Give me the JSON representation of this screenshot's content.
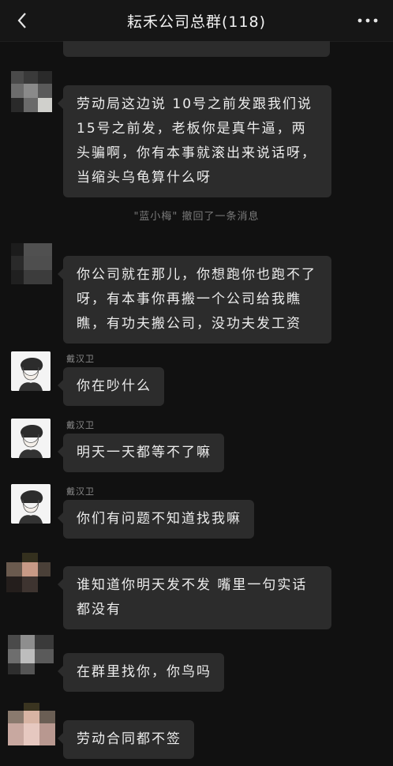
{
  "header": {
    "title": "耘禾公司总群(118)",
    "back_icon": "chevron-left-icon",
    "more_icon": "more-dots-icon"
  },
  "messages": [
    {
      "type": "text",
      "sender": "",
      "avatar": "pixelated",
      "text": "劳动局这边说 10号之前发跟我们说 15号之前发，老板你是真牛逼，两头骗啊，你有本事就滚出来说话呀，当缩头乌龟算什么呀"
    },
    {
      "type": "system",
      "text": "\"蓝小梅\" 撤回了一条消息"
    },
    {
      "type": "text",
      "sender": "",
      "avatar": "pixelated",
      "text": "你公司就在那儿，你想跑你也跑不了呀，有本事你再搬一个公司给我瞧瞧，有功夫搬公司，没功夫发工资"
    },
    {
      "type": "text",
      "sender": "戴汉卫",
      "avatar": "cartoon",
      "text": "你在吵什么"
    },
    {
      "type": "text",
      "sender": "戴汉卫",
      "avatar": "cartoon",
      "text": "明天一天都等不了嘛"
    },
    {
      "type": "text",
      "sender": "戴汉卫",
      "avatar": "cartoon",
      "text": "你们有问题不知道找我嘛"
    },
    {
      "type": "text",
      "sender": "",
      "avatar": "pixelated",
      "text": "谁知道你明天发不发 嘴里一句实话都没有"
    },
    {
      "type": "text",
      "sender": "",
      "avatar": "pixelated",
      "text": "在群里找你，你鸟吗"
    },
    {
      "type": "text",
      "sender": "",
      "avatar": "pixelated",
      "text": "劳动合同都不签"
    }
  ]
}
